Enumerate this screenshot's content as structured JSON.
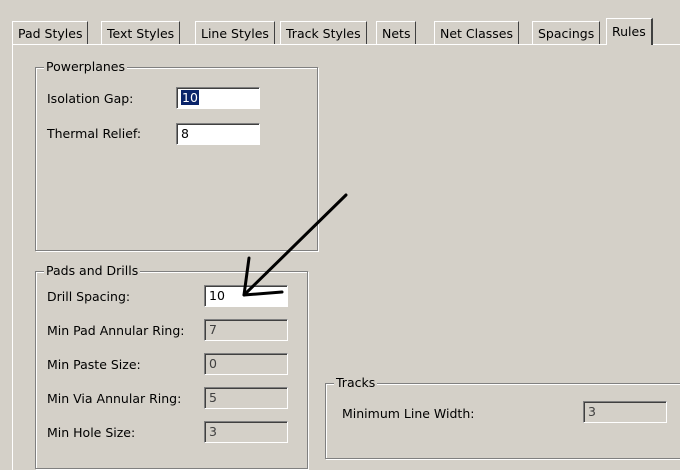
{
  "tabs": [
    {
      "label": "Pad Styles"
    },
    {
      "label": "Text Styles"
    },
    {
      "label": "Line Styles"
    },
    {
      "label": "Track Styles"
    },
    {
      "label": "Nets"
    },
    {
      "label": "Net Classes"
    },
    {
      "label": "Spacings"
    },
    {
      "label": "Rules"
    }
  ],
  "active_tab": "Rules",
  "powerplanes": {
    "title": "Powerplanes",
    "isolation_gap_label": "Isolation Gap:",
    "isolation_gap_value": "10",
    "thermal_relief_label": "Thermal Relief:",
    "thermal_relief_value": "8"
  },
  "pads_drills": {
    "title": "Pads and Drills",
    "drill_spacing_label": "Drill Spacing:",
    "drill_spacing_value": "10",
    "min_pad_annular_label": "Min Pad Annular Ring:",
    "min_pad_annular_value": "7",
    "min_paste_label": "Min Paste Size:",
    "min_paste_value": "0",
    "min_via_annular_label": "Min Via Annular Ring:",
    "min_via_annular_value": "5",
    "min_hole_label": "Min Hole Size:",
    "min_hole_value": "3"
  },
  "tracks": {
    "title": "Tracks",
    "min_line_width_label": "Minimum Line Width:",
    "min_line_width_value": "3"
  },
  "annotation": {
    "icon": "arrow-icon",
    "color": "#000000"
  }
}
